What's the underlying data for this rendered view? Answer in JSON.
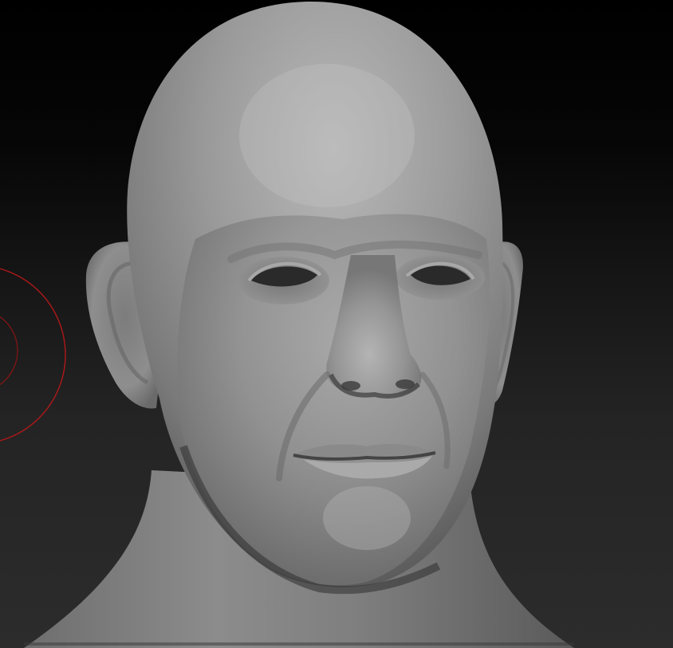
{
  "viewport": {
    "background_top": "#000000",
    "background_bottom": "#2c2c2c"
  },
  "model": {
    "name": "sculpted-head-bust",
    "material_color": "#8f8f8f"
  },
  "brush_cursor": {
    "color": "#b01818",
    "icon": "brush-radius-circle-icon"
  }
}
